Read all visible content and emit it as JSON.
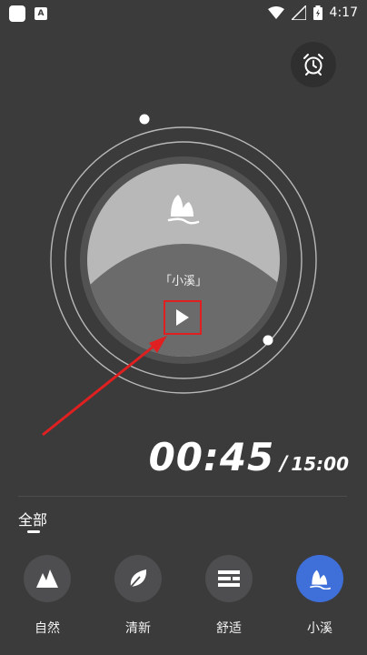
{
  "status": {
    "time": "4:17",
    "notif_a": "A",
    "icons": [
      "notification-square-icon",
      "notification-a-icon",
      "wifi-icon",
      "signal-icon",
      "battery-icon"
    ]
  },
  "alarm": {
    "icon": "alarm-clock-icon"
  },
  "player": {
    "track_name": "「小溪」",
    "track_icon": "stream-icon",
    "play_icon": "play-icon",
    "highlight_color": "#e02020",
    "arrow_color": "#e02020"
  },
  "timer": {
    "elapsed": "00:45",
    "separator": "/",
    "total": "15:00"
  },
  "filter": {
    "all": "全部"
  },
  "categories": [
    {
      "label": "自然",
      "icon": "mountain-icon",
      "active": false
    },
    {
      "label": "清新",
      "icon": "leaf-icon",
      "active": false
    },
    {
      "label": "舒适",
      "icon": "comfort-icon",
      "active": false
    },
    {
      "label": "小溪",
      "icon": "stream-icon",
      "active": true
    }
  ],
  "colors": {
    "background": "#3b3b3c",
    "active": "#3f6fd9"
  }
}
